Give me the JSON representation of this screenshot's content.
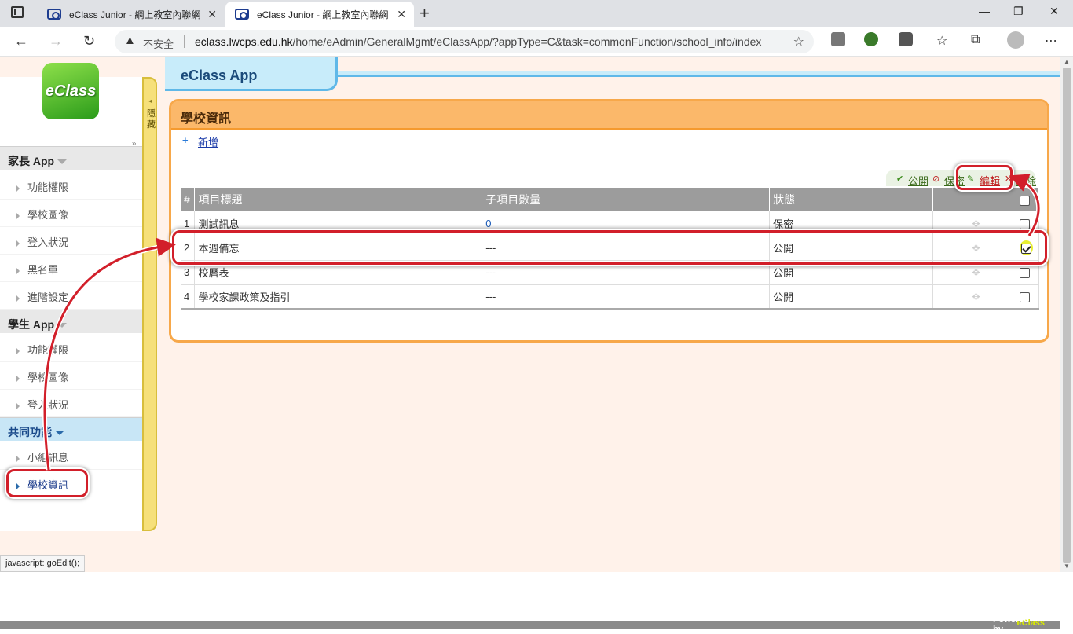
{
  "browser": {
    "tabs": [
      {
        "title": "eClass Junior - 網上教室內聯網"
      },
      {
        "title": "eClass Junior - 網上教室內聯網"
      }
    ],
    "not_secure": "不安全",
    "url_host": "eclass.lwcps.edu.hk",
    "url_path": "/home/eAdmin/GeneralMgmt/eClassApp/?appType=C&task=commonFunction/school_info/index"
  },
  "app_title": "eClass App",
  "logo_text": "eClass",
  "hide_label": "隱藏",
  "sidebar": {
    "sections": [
      {
        "title": "家長 App",
        "items": [
          "功能權限",
          "學校圖像",
          "登入狀況",
          "黑名單",
          "進階設定"
        ]
      },
      {
        "title": "學生 App",
        "items": [
          "功能權限",
          "學校圖像",
          "登入狀況"
        ]
      },
      {
        "title": "共同功能",
        "items": [
          "小組訊息",
          "學校資訊"
        ]
      }
    ]
  },
  "panel": {
    "title": "學校資訊",
    "add_label": "新增",
    "actions": {
      "publish": "公開",
      "private": "保密",
      "edit": "編輯",
      "delete": "刪除"
    },
    "columns": [
      "#",
      "項目標題",
      "子項目數量",
      "狀態"
    ],
    "rows": [
      {
        "num": "1",
        "title": "測試訊息",
        "count": "0",
        "status": "保密"
      },
      {
        "num": "2",
        "title": "本週備忘",
        "count": "---",
        "status": "公開"
      },
      {
        "num": "3",
        "title": "校曆表",
        "count": "---",
        "status": "公開"
      },
      {
        "num": "4",
        "title": "學校家課政策及指引",
        "count": "---",
        "status": "公開"
      }
    ]
  },
  "status_bar": "javascript: goEdit();",
  "footer": {
    "powered": "Powered by",
    "brand": "eClass"
  },
  "colors": {
    "accent_orange": "#fbb86a",
    "highlight_red": "#d21f2a",
    "title_blue": "#c8ecfa"
  }
}
